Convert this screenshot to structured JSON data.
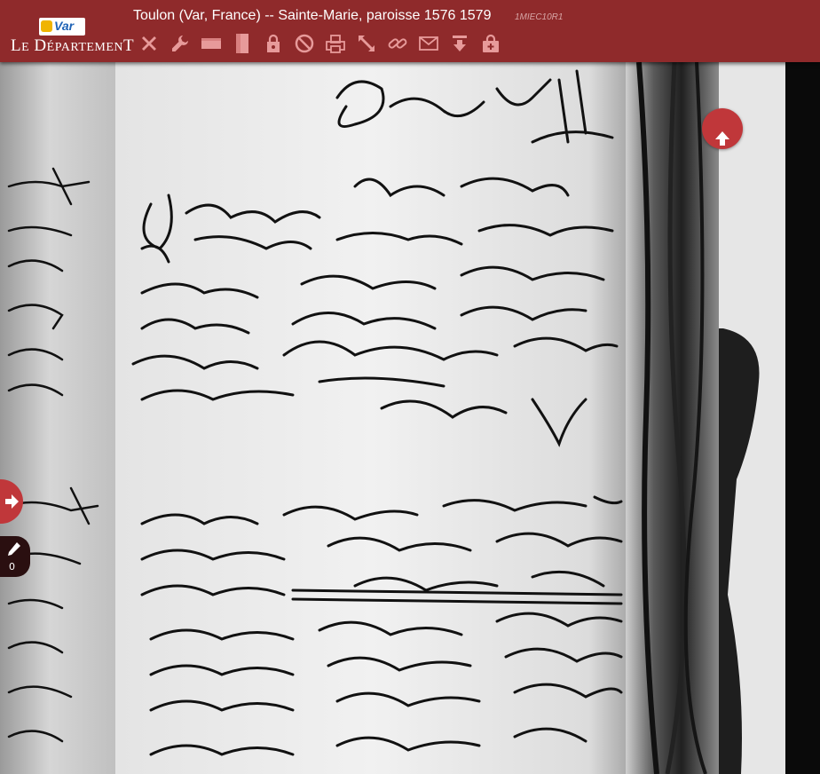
{
  "brand": {
    "logo_badge": "Var",
    "logo_text_le": "L",
    "logo_text_e": "E",
    "logo_text_d": "D",
    "logo_text_rest": "ÉPARTEMEN",
    "logo_text_t": "T"
  },
  "header": {
    "title": "Toulon (Var, France) -- Sainte-Marie, paroisse 1576 1579",
    "cote": "1MIEC10R1"
  },
  "toolbar": {
    "icons": [
      "close-icon",
      "wrench-icon",
      "full-width-icon",
      "full-height-icon",
      "lock-icon",
      "forbidden-icon",
      "print-icon",
      "expand-icon",
      "link-icon",
      "mail-icon",
      "download-icon",
      "lock-add-icon"
    ]
  },
  "notes": {
    "count": "0"
  },
  "colors": {
    "header_bg": "#8f2a2b",
    "accent": "#c0373a",
    "note_bg": "#2a0f10"
  }
}
